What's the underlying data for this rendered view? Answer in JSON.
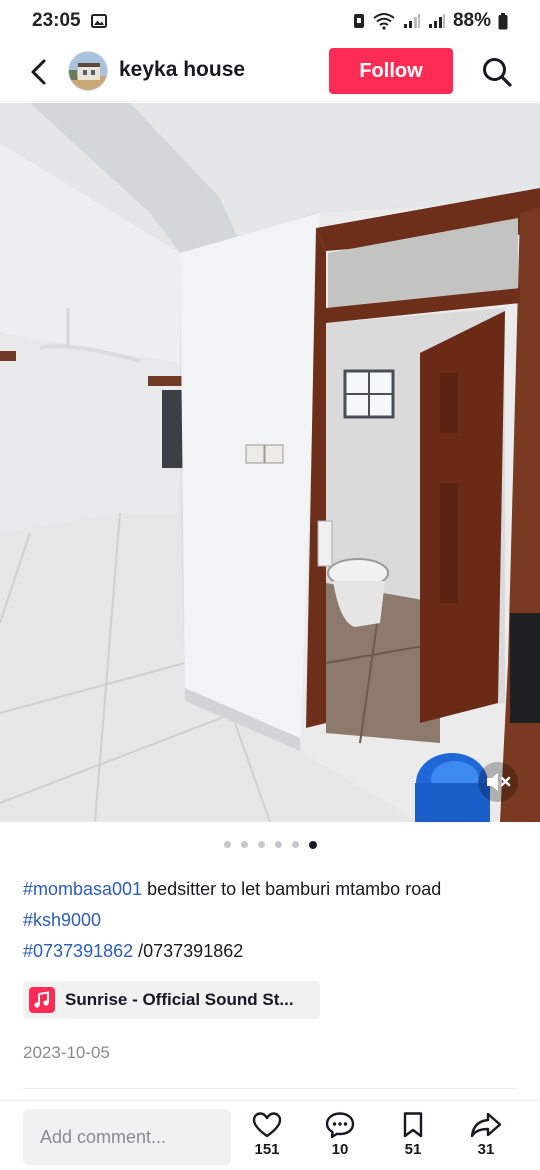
{
  "status_bar": {
    "time": "23:05",
    "battery": "88%"
  },
  "header": {
    "username": "keyka house",
    "follow_label": "Follow"
  },
  "carousel": {
    "total": 6,
    "active_index": 5
  },
  "caption": {
    "hashtag_1": "#mombasa001",
    "text_1": " bedsitter to let bamburi mtambo road",
    "hashtag_2": "#ksh9000",
    "hashtag_3": "#0737391862",
    "text_3": " /0737391862"
  },
  "sound": {
    "title": "Sunrise - Official Sound St..."
  },
  "date": "2023-10-05",
  "bottom_bar": {
    "comment_placeholder": "Add comment...",
    "likes": "151",
    "comments": "10",
    "saves": "51",
    "shares": "31"
  },
  "colors": {
    "brand": "#fe2c55",
    "hashtag": "#2b5db9",
    "muted_text": "#8a8b91"
  },
  "icons": [
    "back-arrow-icon",
    "search-icon",
    "image-icon",
    "wifi-icon",
    "signal-icon",
    "battery-icon",
    "muted-speaker-icon",
    "music-note-icon",
    "heart-icon",
    "comment-bubble-icon",
    "bookmark-icon",
    "share-arrow-icon"
  ]
}
